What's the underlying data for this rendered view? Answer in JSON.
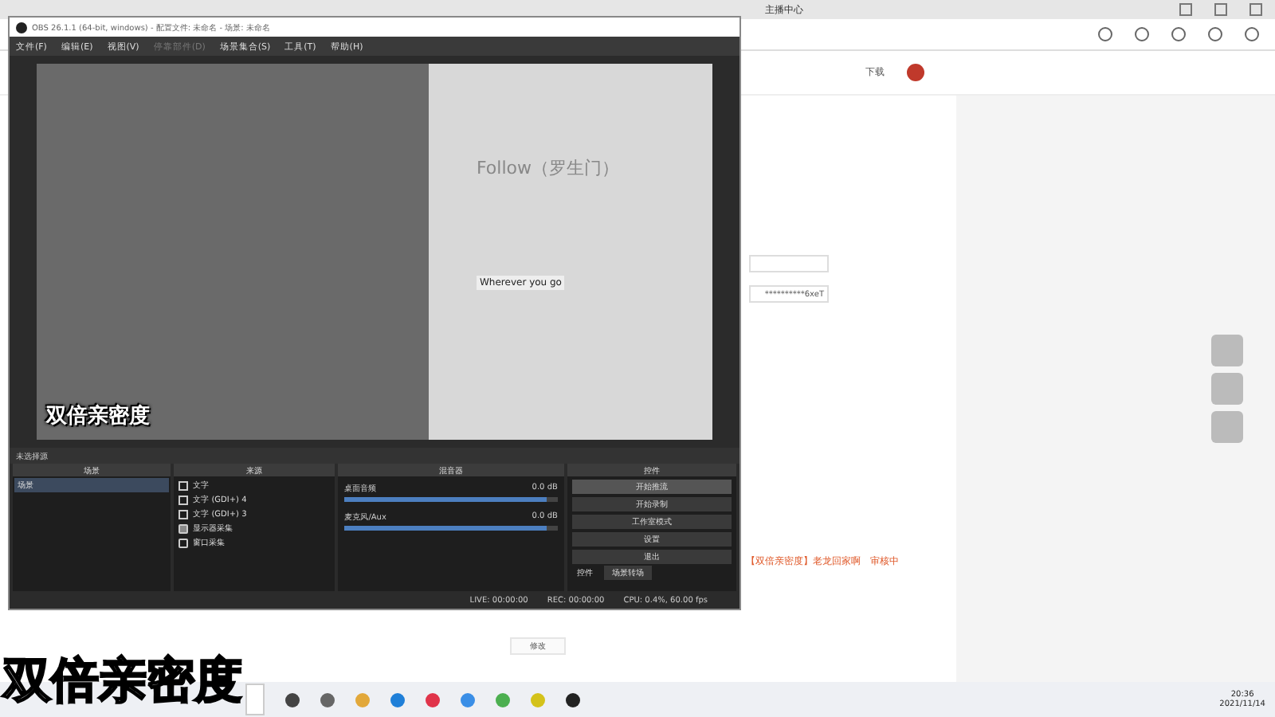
{
  "browser": {
    "tab_title": "主播中心",
    "download": "下载",
    "stream_key_masked": "**********6xeT",
    "status_line": "【双倍亲密度】老龙回家啊",
    "status": "审核中",
    "edit_button": "修改"
  },
  "obs": {
    "title": "OBS 26.1.1 (64-bit, windows) - 配置文件: 未命名 - 场景: 未命名",
    "menu": [
      {
        "label": "文件(F)",
        "disabled": false
      },
      {
        "label": "编辑(E)",
        "disabled": false
      },
      {
        "label": "视图(V)",
        "disabled": false
      },
      {
        "label": "停靠部件(D)",
        "disabled": true
      },
      {
        "label": "场景集合(S)",
        "disabled": false
      },
      {
        "label": "工具(T)",
        "disabled": false
      },
      {
        "label": "帮助(H)",
        "disabled": false
      }
    ],
    "preview": {
      "song_title": "Follow（罗生门）",
      "lyric": "Wherever you go",
      "caption": "双倍亲密度"
    },
    "properties_bar": "未选择源",
    "scenes": {
      "title": "场景",
      "items": [
        {
          "label": "场景",
          "selected": true
        }
      ]
    },
    "sources": {
      "title": "来源",
      "items": [
        {
          "label": "文字",
          "kind": "text"
        },
        {
          "label": "文字 (GDI+) 4",
          "kind": "text"
        },
        {
          "label": "文字 (GDI+) 3",
          "kind": "text"
        },
        {
          "label": "显示器采集",
          "kind": "display"
        },
        {
          "label": "窗口采集",
          "kind": "window"
        }
      ]
    },
    "mixer": {
      "title": "混音器",
      "channels": [
        {
          "name": "桌面音频",
          "reading": "0.0 dB",
          "level": 0.95
        },
        {
          "name": "麦克风/Aux",
          "reading": "0.0 dB",
          "level": 0.95
        }
      ]
    },
    "controls": {
      "title": "控件",
      "buttons": [
        "开始推流",
        "开始录制",
        "工作室模式",
        "设置",
        "退出"
      ]
    },
    "bottom_tabs": [
      {
        "label": "控件",
        "selected": true
      },
      {
        "label": "场景转场",
        "selected": false
      }
    ],
    "status_bar": {
      "live": "LIVE: 00:00:00",
      "rec": "REC: 00:00:00",
      "cpu": "CPU: 0.4%, 60.00 fps"
    }
  },
  "caption": "双倍亲密度",
  "taskbar": {
    "time": "20:36",
    "date": "2021/11/14"
  }
}
